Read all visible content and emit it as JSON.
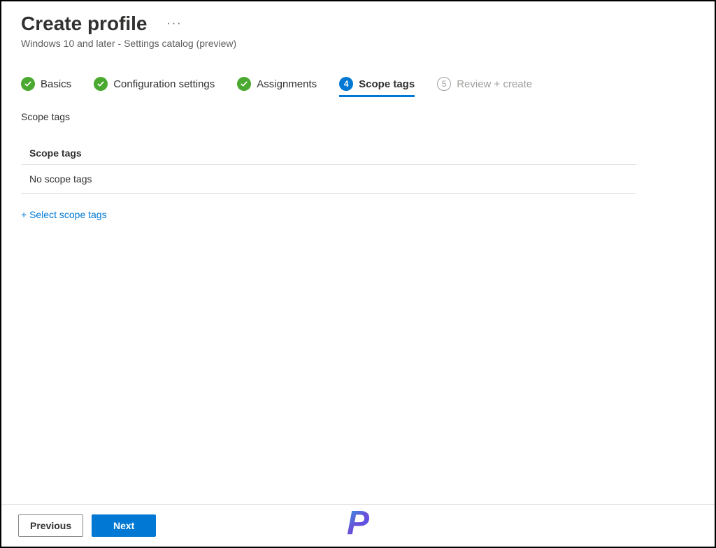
{
  "header": {
    "title": "Create profile",
    "subtitle": "Windows 10 and later - Settings catalog (preview)"
  },
  "wizard": {
    "steps": [
      {
        "label": "Basics",
        "state": "done"
      },
      {
        "label": "Configuration settings",
        "state": "done"
      },
      {
        "label": "Assignments",
        "state": "done"
      },
      {
        "label": "Scope tags",
        "state": "active",
        "num": "4"
      },
      {
        "label": "Review + create",
        "state": "future",
        "num": "5"
      }
    ]
  },
  "content": {
    "section_label": "Scope tags",
    "table_header": "Scope tags",
    "empty_text": "No scope tags",
    "add_link": "+ Select scope tags"
  },
  "footer": {
    "previous": "Previous",
    "next": "Next"
  },
  "brand": "P"
}
